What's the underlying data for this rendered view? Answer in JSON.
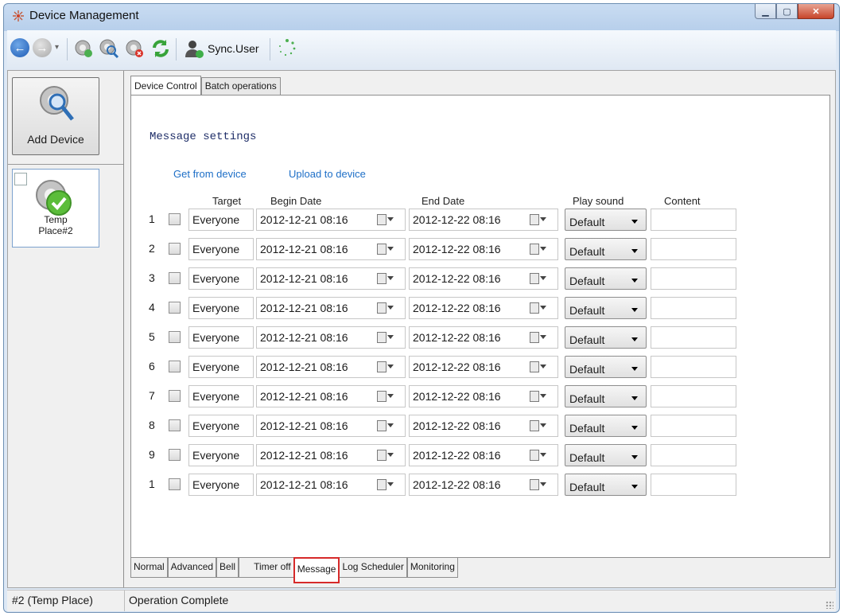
{
  "window": {
    "title": "Device Management"
  },
  "toolbar": {
    "sync_user": "Sync.User"
  },
  "sidebar": {
    "add_device": "Add Device",
    "device": {
      "line1": "Temp",
      "line2": "Place#2"
    }
  },
  "tabs": {
    "device_control": "Device Control",
    "batch_operations": "Batch operations"
  },
  "message": {
    "title": "Message settings",
    "get_from_device": "Get from device",
    "upload_to_device": "Upload to device",
    "headers": {
      "target": "Target",
      "begin_date": "Begin Date",
      "end_date": "End Date",
      "play_sound": "Play sound",
      "content": "Content"
    },
    "rows": [
      {
        "num": "1",
        "target": "Everyone",
        "begin": "2012-12-21 08:16",
        "end": "2012-12-22 08:16",
        "sound": "Default",
        "content": ""
      },
      {
        "num": "2",
        "target": "Everyone",
        "begin": "2012-12-21 08:16",
        "end": "2012-12-22 08:16",
        "sound": "Default",
        "content": ""
      },
      {
        "num": "3",
        "target": "Everyone",
        "begin": "2012-12-21 08:16",
        "end": "2012-12-22 08:16",
        "sound": "Default",
        "content": ""
      },
      {
        "num": "4",
        "target": "Everyone",
        "begin": "2012-12-21 08:16",
        "end": "2012-12-22 08:16",
        "sound": "Default",
        "content": ""
      },
      {
        "num": "5",
        "target": "Everyone",
        "begin": "2012-12-21 08:16",
        "end": "2012-12-22 08:16",
        "sound": "Default",
        "content": ""
      },
      {
        "num": "6",
        "target": "Everyone",
        "begin": "2012-12-21 08:16",
        "end": "2012-12-22 08:16",
        "sound": "Default",
        "content": ""
      },
      {
        "num": "7",
        "target": "Everyone",
        "begin": "2012-12-21 08:16",
        "end": "2012-12-22 08:16",
        "sound": "Default",
        "content": ""
      },
      {
        "num": "8",
        "target": "Everyone",
        "begin": "2012-12-21 08:16",
        "end": "2012-12-22 08:16",
        "sound": "Default",
        "content": ""
      },
      {
        "num": "9",
        "target": "Everyone",
        "begin": "2012-12-21 08:16",
        "end": "2012-12-22 08:16",
        "sound": "Default",
        "content": ""
      },
      {
        "num": "1",
        "target": "Everyone",
        "begin": "2012-12-21 08:16",
        "end": "2012-12-22 08:16",
        "sound": "Default",
        "content": ""
      }
    ]
  },
  "bottom_tabs": [
    "Normal",
    "Advanced",
    "Bell",
    "Timer off",
    "Message",
    "Log Scheduler",
    "Monitoring"
  ],
  "bottom_tab_active": "Message",
  "status": {
    "left": "#2 (Temp Place)",
    "right": "Operation Complete"
  },
  "colors": {
    "link": "#1e6fc7",
    "highlight": "#d62a2a",
    "title_text": "#1f2e68"
  }
}
